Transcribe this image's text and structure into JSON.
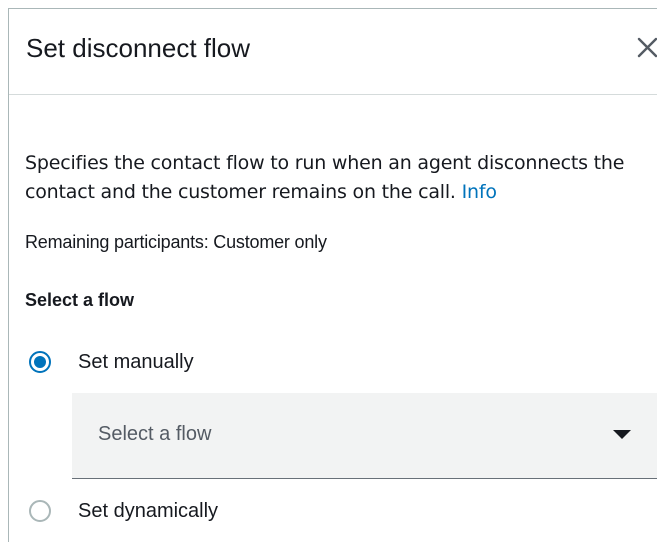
{
  "dialog": {
    "title": "Set disconnect flow",
    "close_icon": "close-icon"
  },
  "description": {
    "text": "Specifies the contact flow to run when an agent disconnects the contact and the customer remains on the call.",
    "info_link": "Info"
  },
  "remaining_participants": "Remaining participants: Customer only",
  "flow_selection": {
    "label": "Select a flow",
    "options": [
      {
        "label": "Set manually",
        "selected": true
      },
      {
        "label": "Set dynamically",
        "selected": false
      }
    ],
    "dropdown": {
      "placeholder": "Select a flow",
      "caret_icon": "caret-down-icon"
    }
  },
  "colors": {
    "accent": "#0073bb",
    "text": "#16191f",
    "select_bg": "#f2f3f3",
    "border": "#aab7b8"
  }
}
